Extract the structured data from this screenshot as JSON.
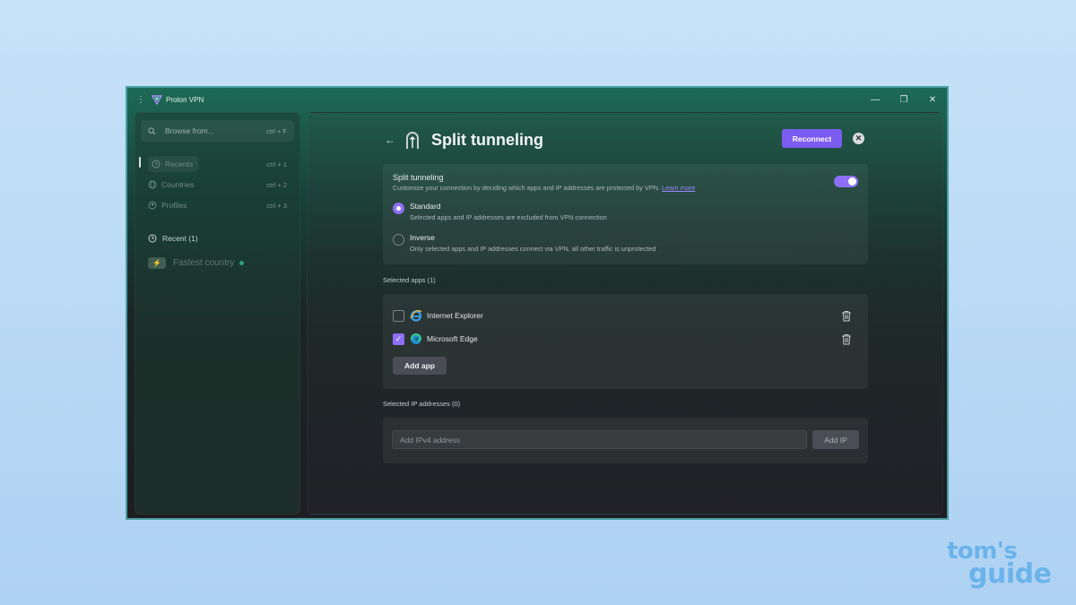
{
  "window": {
    "title": "Proton VPN",
    "menu_icon": "kebab-menu-icon",
    "controls": [
      "minimize-icon",
      "restore-icon",
      "close-icon"
    ]
  },
  "sidebar": {
    "search": {
      "placeholder": "Browse from...",
      "shortcut": "ctrl + F"
    },
    "nav": [
      {
        "label": "Recents",
        "shortcut": "ctrl + 1",
        "icon": "clock-icon",
        "active": true
      },
      {
        "label": "Countries",
        "shortcut": "ctrl + 2",
        "icon": "globe-icon",
        "active": false
      },
      {
        "label": "Profiles",
        "shortcut": "ctrl + 3",
        "icon": "profile-icon",
        "active": false
      }
    ],
    "recent_header": "Recent (1)",
    "fastest": "Fastest country"
  },
  "main": {
    "back_icon": "arrow-left-icon",
    "title": "Split tunneling",
    "reconnect_label": "Reconnect",
    "split": {
      "title": "Split tunneling",
      "description": "Customize your connection by deciding which apps and IP addresses are protected by VPN.",
      "learn_more": "Learn more",
      "enabled": true,
      "modes": [
        {
          "label": "Standard",
          "sub": "Selected apps and IP addresses are excluded from VPN connection",
          "selected": true
        },
        {
          "label": "Inverse",
          "sub": "Only selected apps and IP addresses connect via VPN, all other traffic is unprotected",
          "selected": false
        }
      ]
    },
    "apps_label": "Selected apps (1)",
    "apps": [
      {
        "name": "Internet Explorer",
        "checked": false,
        "icon": "internet-explorer-icon"
      },
      {
        "name": "Microsoft Edge",
        "checked": true,
        "icon": "microsoft-edge-icon"
      }
    ],
    "add_app_label": "Add app",
    "ip_label": "Selected IP addresses (0)",
    "ip_placeholder": "Add IPv4 address",
    "add_ip_label": "Add IP"
  },
  "watermark": {
    "line1": "tom's",
    "line2": "guide"
  },
  "colors": {
    "accent": "#7b5cf0",
    "toggle": "#8e6ff5",
    "background": "#b7d8f5"
  }
}
